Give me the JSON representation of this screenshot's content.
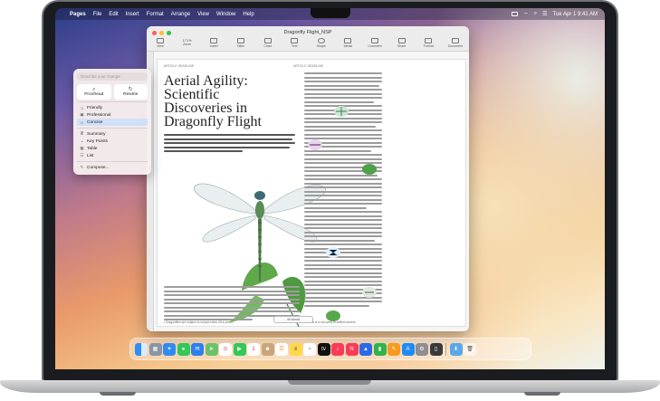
{
  "menubar": {
    "app_name": "Pages",
    "menus": [
      "File",
      "Edit",
      "Insert",
      "Format",
      "Arrange",
      "View",
      "Window",
      "Help"
    ],
    "clock": "Tue Apr 1  9:41 AM"
  },
  "document": {
    "title": "Dragonfly Flight_NSP",
    "zoom": "171%",
    "toolbar": [
      "View",
      "Zoom",
      "Insert",
      "Table",
      "Chart",
      "Text",
      "Shape",
      "Media",
      "Comment",
      "Share",
      "Format",
      "Document"
    ],
    "header_left": "ARTICLE HEADLINE",
    "header_right": "ARTICLE HEADLINE",
    "headline": "Aerial Agility: Scientific Discoveries in Dragonfly Flight",
    "word_count": "46 words",
    "footnote_left": "• Dragonflies are subject to unique sheer lift to perch",
    "footnote_right": "• Maths is a non-prey to skilled hunters"
  },
  "writing_tools": {
    "placeholder": "Describe your change",
    "proofread": "Proofread",
    "rewrite": "Rewrite",
    "tones": [
      "Friendly",
      "Professional",
      "Concise"
    ],
    "formats": [
      "Summary",
      "Key Points",
      "Table",
      "List"
    ],
    "compose": "Compose..."
  },
  "dock": {
    "apps": [
      "finder-icon",
      "launchpad-icon",
      "safari-icon",
      "messages-icon",
      "mail-icon",
      "maps-icon",
      "photos-icon",
      "facetime-icon",
      "calendar-icon",
      "contacts-icon",
      "reminders-icon",
      "notes-icon",
      "freeform-icon",
      "tv-icon",
      "music-icon",
      "news-icon",
      "keynote-icon",
      "numbers-icon",
      "pages-icon",
      "app-store-icon",
      "system-settings-icon",
      "iphone-mirroring-icon",
      "downloads-icon",
      "trash-icon"
    ]
  }
}
